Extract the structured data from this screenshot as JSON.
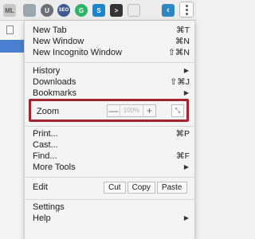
{
  "toolbar": {
    "extensions": [
      {
        "icon": "mail-icon",
        "label": "ML",
        "color": "#c8c8c8"
      },
      {
        "icon": "leaf-icon",
        "label": "",
        "color": "#9aa7b0"
      },
      {
        "icon": "shield-icon",
        "label": "U",
        "color": "#6a6f78"
      },
      {
        "icon": "badge-icon",
        "label": "SEO",
        "color": "#3d5a95"
      },
      {
        "icon": "grammarly-icon",
        "label": "G",
        "color": "#2fb46a"
      },
      {
        "icon": "skype-icon",
        "label": "S",
        "color": "#1d86c8"
      },
      {
        "icon": "terminal-icon",
        "label": ">",
        "color": "#333333"
      },
      {
        "icon": "box-icon",
        "label": "",
        "color": "#eaeaea"
      },
      {
        "icon": "back-icon",
        "label": "‹",
        "color": "#2f86c5"
      }
    ]
  },
  "menu": {
    "new_tab": {
      "label": "New Tab",
      "shortcut": "⌘T"
    },
    "new_window": {
      "label": "New Window",
      "shortcut": "⌘N"
    },
    "new_incognito": {
      "label": "New Incognito Window",
      "shortcut": "⇧⌘N"
    },
    "history": {
      "label": "History"
    },
    "downloads": {
      "label": "Downloads",
      "shortcut": "⇧⌘J"
    },
    "bookmarks": {
      "label": "Bookmarks"
    },
    "zoom": {
      "label": "Zoom",
      "minus": "—",
      "value": "100%",
      "plus": "+"
    },
    "print": {
      "label": "Print...",
      "shortcut": "⌘P"
    },
    "cast": {
      "label": "Cast..."
    },
    "find": {
      "label": "Find...",
      "shortcut": "⌘F"
    },
    "more_tools": {
      "label": "More Tools"
    },
    "edit": {
      "label": "Edit",
      "cut": "Cut",
      "copy": "Copy",
      "paste": "Paste"
    },
    "settings": {
      "label": "Settings"
    },
    "help": {
      "label": "Help"
    }
  },
  "colors": {
    "highlight_border": "#a4232a",
    "page_accent": "#4a7fd0"
  }
}
